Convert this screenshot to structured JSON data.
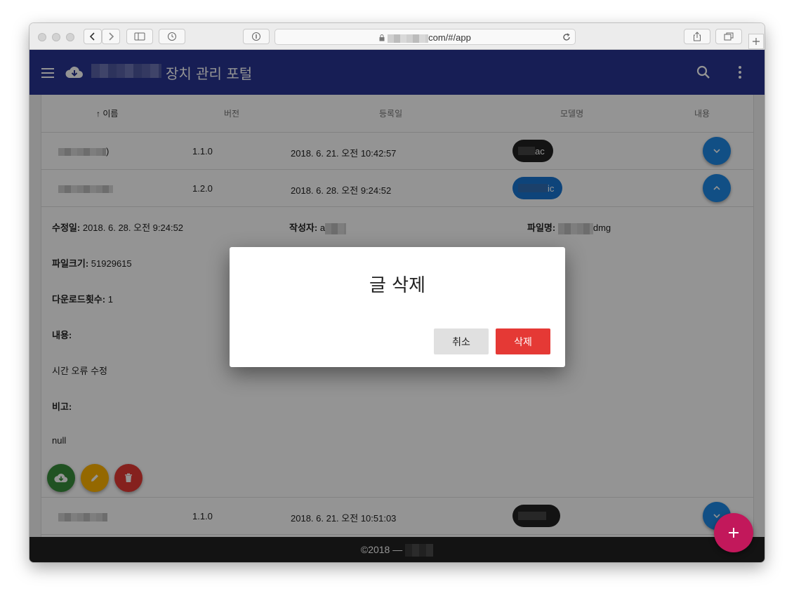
{
  "browser": {
    "url_suffix": "com/#/app"
  },
  "appbar": {
    "title": "장치 관리 포털",
    "menu_icon": "menu-icon",
    "logo_icon": "cloud-download-icon",
    "search_icon": "search-icon",
    "more_icon": "more-vert-icon",
    "color": "#283593"
  },
  "table": {
    "headers": {
      "name": "이름",
      "version": "버전",
      "registered": "등록일",
      "model": "모델명",
      "content": "내용"
    },
    "rows": [
      {
        "name_suffix": ")",
        "version": "1.1.0",
        "date": "2018. 6. 21. 오전 10:42:57",
        "model_suffix": "ac",
        "chip_color": "#212121"
      },
      {
        "name_suffix": "",
        "version": "1.2.0",
        "date": "2018. 6. 28. 오전 9:24:52",
        "model_suffix": "ic",
        "chip_color": "#1976d2"
      },
      {
        "name_suffix": "",
        "version": "1.1.0",
        "date": "2018. 6. 21. 오전 10:51:03",
        "model_suffix": "",
        "chip_color": "#212121"
      }
    ]
  },
  "detail": {
    "modified_label": "수정일:",
    "modified_value": "2018. 6. 28. 오전 9:24:52",
    "author_label": "작성자:",
    "author_value": "a",
    "filename_label": "파일명:",
    "filename_suffix": "dmg",
    "filesize_label": "파일크기:",
    "filesize_value": "51929615",
    "downloads_label": "다운로드횟수:",
    "downloads_value": "1",
    "content_label": "내용:",
    "content_value": "시간 오류 수정",
    "note_label": "비고:",
    "note_value": "null"
  },
  "actions": {
    "download_icon": "cloud-download-icon",
    "edit_icon": "pencil-icon",
    "delete_icon": "trash-icon",
    "download_color": "#388e3c",
    "edit_color": "#ffb300",
    "delete_color": "#e53935"
  },
  "footer": {
    "text": "©2018 —"
  },
  "fab": {
    "icon": "plus-icon",
    "color": "#c2185b"
  },
  "dialog": {
    "title": "글 삭제",
    "cancel_label": "취소",
    "delete_label": "삭제",
    "delete_color": "#e53935"
  }
}
